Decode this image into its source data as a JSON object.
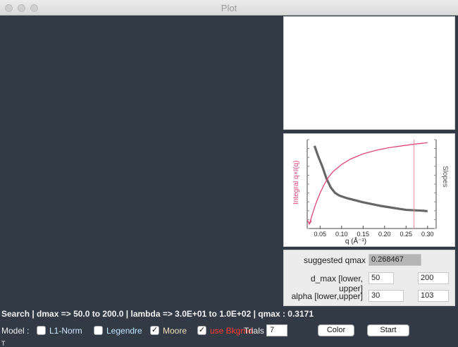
{
  "window": {
    "title": "Plot"
  },
  "plot": {
    "left_axis_label": "Integral q×I(q)",
    "right_axis_label": "Slopes",
    "xlabel": "q (Å⁻¹)",
    "x_ticks": [
      "0.05",
      "0.10",
      "0.15",
      "0.20",
      "0.25",
      "0.30"
    ]
  },
  "form": {
    "suggested_qmax_label": "suggested qmax",
    "suggested_qmax_value": "0.268467",
    "dmax_label": "d_max [lower, upper]",
    "dmax_lower": "50",
    "dmax_upper": "200",
    "alpha_label": "alpha [lower,upper]",
    "alpha_lower": "30",
    "alpha_upper": "103"
  },
  "status": {
    "text": "Search | dmax => 50.0 to 200.0 | lambda => 3.0E+01 to 1.0E+02 | qmax : 0.3171"
  },
  "controls": {
    "model_label": "Model :",
    "l1_norm_label": "L1-Norm",
    "legendre_label": "Legendre",
    "moore_label": "Moore",
    "use_bkgrnd_label": "use Bkgrnd",
    "trials_label": "Trials",
    "trials_value": "7",
    "color_button": "Color",
    "start_button": "Start",
    "l1_norm_checked": false,
    "legendre_checked": false,
    "moore_checked": true,
    "use_bkgrnd_checked": true
  },
  "footer": {
    "glyph": "T"
  },
  "colors": {
    "background": "#323a46",
    "integral_curve": "#e0457b",
    "slopes_curve": "#666666",
    "qmax_line": "#f08a9a",
    "l1_norm_text": "#cfe9ff",
    "legendre_text": "#bfe7ff",
    "moore_text": "#f3e3bb",
    "use_bkgrnd_text": "#ff3b30"
  },
  "chart_data": {
    "type": "line",
    "xlabel": "q (Å⁻¹)",
    "ylabel": "Integral q×I(q)",
    "y2label": "Slopes",
    "xlim": [
      0.02,
      0.32
    ],
    "ylim": [
      0,
      1
    ],
    "series": [
      {
        "x": [
          0.025,
          0.03,
          0.04,
          0.05,
          0.06,
          0.07,
          0.08,
          0.1,
          0.12,
          0.15,
          0.18,
          0.21,
          0.24,
          0.27,
          0.3
        ],
        "values": [
          0.05,
          0.13,
          0.28,
          0.4,
          0.5,
          0.58,
          0.64,
          0.72,
          0.78,
          0.84,
          0.88,
          0.91,
          0.93,
          0.95,
          0.965
        ]
      },
      {
        "x": [
          0.037,
          0.045,
          0.055,
          0.065,
          0.075,
          0.085,
          0.095,
          0.11,
          0.13,
          0.15,
          0.17,
          0.19,
          0.21,
          0.23,
          0.25,
          0.27,
          0.29,
          0.3
        ],
        "values": [
          0.93,
          0.82,
          0.7,
          0.56,
          0.46,
          0.4,
          0.37,
          0.345,
          0.32,
          0.295,
          0.275,
          0.255,
          0.24,
          0.225,
          0.21,
          0.205,
          0.2,
          0.195
        ]
      }
    ],
    "markers": [
      {
        "type": "vline",
        "x": 0.268467
      }
    ]
  }
}
